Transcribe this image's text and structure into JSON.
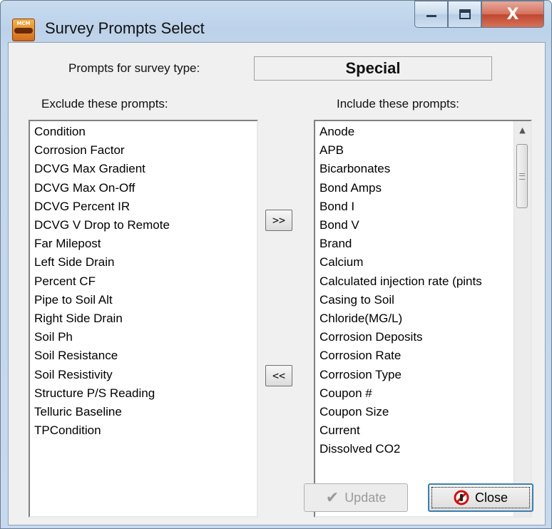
{
  "window": {
    "title": "Survey Prompts Select",
    "icon_text": "MCM",
    "controls": {
      "minimize": "▁",
      "maximize": "▢",
      "close": "X"
    }
  },
  "survey_type": {
    "label": "Prompts for survey type:",
    "value": "Special"
  },
  "exclude": {
    "header": "Exclude these prompts:",
    "items": [
      "Condition",
      "Corrosion Factor",
      "DCVG Max Gradient",
      "DCVG Max On-Off",
      "DCVG Percent IR",
      "DCVG V Drop to Remote",
      "Far Milepost",
      "Left Side Drain",
      "Percent CF",
      "Pipe to Soil Alt",
      "Right Side Drain",
      "Soil Ph",
      "Soil Resistance",
      "Soil Resistivity",
      "Structure P/S Reading",
      "Telluric Baseline",
      "TPCondition"
    ]
  },
  "include": {
    "header": "Include these prompts:",
    "items": [
      "Anode",
      "APB",
      "Bicarbonates",
      "Bond Amps",
      "Bond I",
      "Bond V",
      "Brand",
      "Calcium",
      "Calculated injection rate (pints",
      "Casing to Soil",
      "Chloride(MG/L)",
      "Corrosion Deposits",
      "Corrosion Rate",
      "Corrosion Type",
      "Coupon #",
      "Coupon Size",
      "Current",
      "Dissolved CO2"
    ]
  },
  "buttons": {
    "move_right": ">>",
    "move_left": "<<",
    "update": "Update",
    "close": "Close"
  },
  "icons": {
    "update": "check-icon",
    "close": "no-entry-icon",
    "scroll_up": "▲",
    "scroll_down": "▼"
  }
}
